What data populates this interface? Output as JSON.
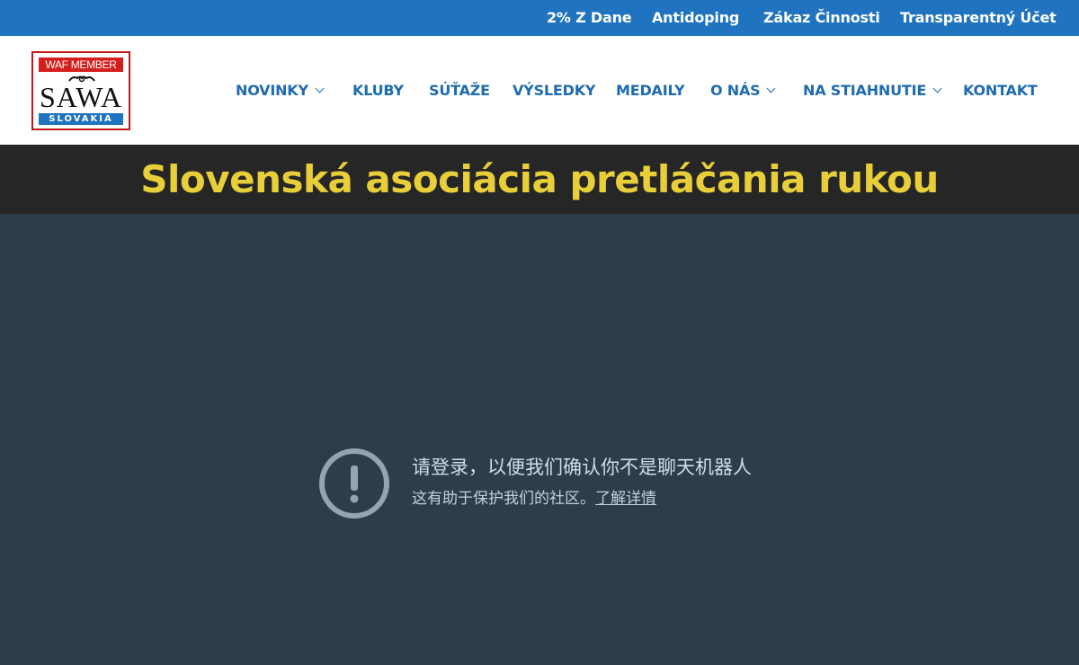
{
  "topbar": {
    "links": [
      "2% Z Dane",
      "Antidoping",
      "Zákaz Činnosti",
      "Transparentný Účet"
    ]
  },
  "logo": {
    "top_text": "WAF MEMBER",
    "main_text": "SAWA",
    "bottom_text": "SLOVAKIA"
  },
  "nav": {
    "items": [
      {
        "label": "NOVINKY",
        "has_dropdown": true
      },
      {
        "label": "KLUBY",
        "has_dropdown": false
      },
      {
        "label": "SÚŤAŽE",
        "has_dropdown": false
      },
      {
        "label": "VÝSLEDKY",
        "has_dropdown": false
      },
      {
        "label": "MEDAILY",
        "has_dropdown": false
      },
      {
        "label": "O NÁS",
        "has_dropdown": true
      },
      {
        "label": "NA STIAHNUTIE",
        "has_dropdown": true
      },
      {
        "label": "KONTAKT",
        "has_dropdown": false
      }
    ]
  },
  "site_title": "Slovenská asociácia pretláčania rukou",
  "notice": {
    "icon": "exclamation-circle-icon",
    "title": "请登录，以便我们确认你不是聊天机器人",
    "subtitle": "这有助于保护我们的社区。",
    "link": "了解详情"
  },
  "colors": {
    "topbar": "#1f73bf",
    "nav_text": "#1f6bb0",
    "title_bg": "#262626",
    "title_text": "#e8cf3a",
    "main_bg": "#2c3e4c"
  }
}
